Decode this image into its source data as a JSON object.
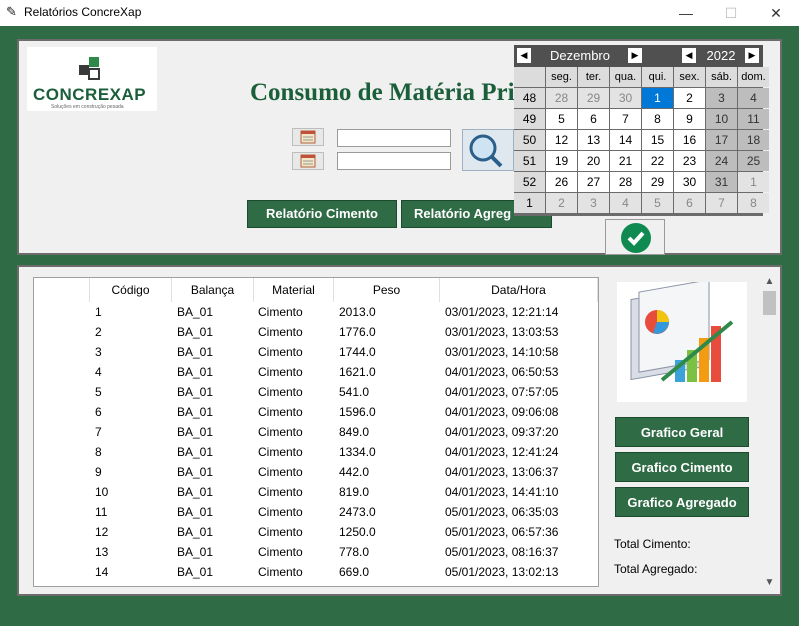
{
  "window": {
    "title": "Relatórios ConcreXap",
    "minimize": "—",
    "maximize": "☐",
    "close": "✕"
  },
  "logo": {
    "name": "CONCREXAP",
    "tagline": "Soluções em construção pesada"
  },
  "page_title": "Consumo de Matéria Pri",
  "buttons": {
    "relatorio_cimento": "Relatório Cimento",
    "relatorio_agregado": "Relatório Agreg",
    "grafico_geral": "Grafico Geral",
    "grafico_cimento": "Grafico Cimento",
    "grafico_agregado": "Grafico Agregado"
  },
  "calendar": {
    "month": "Dezembro",
    "year": "2022",
    "weekdays": [
      "seg.",
      "ter.",
      "qua.",
      "qui.",
      "sex.",
      "sáb.",
      "dom."
    ],
    "weeks": [
      {
        "wk": "48",
        "days": [
          "28",
          "29",
          "30",
          "1",
          "2",
          "3",
          "4"
        ],
        "kinds": [
          "other",
          "other",
          "other",
          "sel",
          "day",
          "weekend",
          "weekend"
        ]
      },
      {
        "wk": "49",
        "days": [
          "5",
          "6",
          "7",
          "8",
          "9",
          "10",
          "11"
        ],
        "kinds": [
          "day",
          "day",
          "day",
          "day",
          "day",
          "weekend",
          "weekend"
        ]
      },
      {
        "wk": "50",
        "days": [
          "12",
          "13",
          "14",
          "15",
          "16",
          "17",
          "18"
        ],
        "kinds": [
          "day",
          "day",
          "day",
          "day",
          "day",
          "weekend",
          "weekend"
        ]
      },
      {
        "wk": "51",
        "days": [
          "19",
          "20",
          "21",
          "22",
          "23",
          "24",
          "25"
        ],
        "kinds": [
          "day",
          "day",
          "day",
          "day",
          "day",
          "weekend",
          "weekend"
        ]
      },
      {
        "wk": "52",
        "days": [
          "26",
          "27",
          "28",
          "29",
          "30",
          "31",
          "1"
        ],
        "kinds": [
          "day",
          "day",
          "day",
          "day",
          "day",
          "weekend",
          "other"
        ]
      },
      {
        "wk": "1",
        "days": [
          "2",
          "3",
          "4",
          "5",
          "6",
          "7",
          "8"
        ],
        "kinds": [
          "other",
          "other",
          "other",
          "other",
          "other",
          "other",
          "other"
        ]
      }
    ]
  },
  "table": {
    "columns": [
      "",
      "Código",
      "Balança",
      "Material",
      "Peso",
      "Data/Hora"
    ],
    "rows": [
      [
        "1",
        "BA_01",
        "Cimento",
        "2013.0",
        "03/01/2023, 12:21:14"
      ],
      [
        "2",
        "BA_01",
        "Cimento",
        "1776.0",
        "03/01/2023, 13:03:53"
      ],
      [
        "3",
        "BA_01",
        "Cimento",
        "1744.0",
        "03/01/2023, 14:10:58"
      ],
      [
        "4",
        "BA_01",
        "Cimento",
        "1621.0",
        "04/01/2023, 06:50:53"
      ],
      [
        "5",
        "BA_01",
        "Cimento",
        "541.0",
        "04/01/2023, 07:57:05"
      ],
      [
        "6",
        "BA_01",
        "Cimento",
        "1596.0",
        "04/01/2023, 09:06:08"
      ],
      [
        "7",
        "BA_01",
        "Cimento",
        "849.0",
        "04/01/2023, 09:37:20"
      ],
      [
        "8",
        "BA_01",
        "Cimento",
        "1334.0",
        "04/01/2023, 12:41:24"
      ],
      [
        "9",
        "BA_01",
        "Cimento",
        "442.0",
        "04/01/2023, 13:06:37"
      ],
      [
        "10",
        "BA_01",
        "Cimento",
        "819.0",
        "04/01/2023, 14:41:10"
      ],
      [
        "11",
        "BA_01",
        "Cimento",
        "2473.0",
        "05/01/2023, 06:35:03"
      ],
      [
        "12",
        "BA_01",
        "Cimento",
        "1250.0",
        "05/01/2023, 06:57:36"
      ],
      [
        "13",
        "BA_01",
        "Cimento",
        "778.0",
        "05/01/2023, 08:16:37"
      ],
      [
        "14",
        "BA_01",
        "Cimento",
        "669.0",
        "05/01/2023, 13:02:13"
      ]
    ]
  },
  "totals": {
    "cimento_label": "Total Cimento:",
    "agregado_label": "Total Agregado:"
  },
  "colors": {
    "brand_green": "#2f6b45",
    "title_green": "#1b5e3a",
    "selected_day": "#0078d7"
  }
}
